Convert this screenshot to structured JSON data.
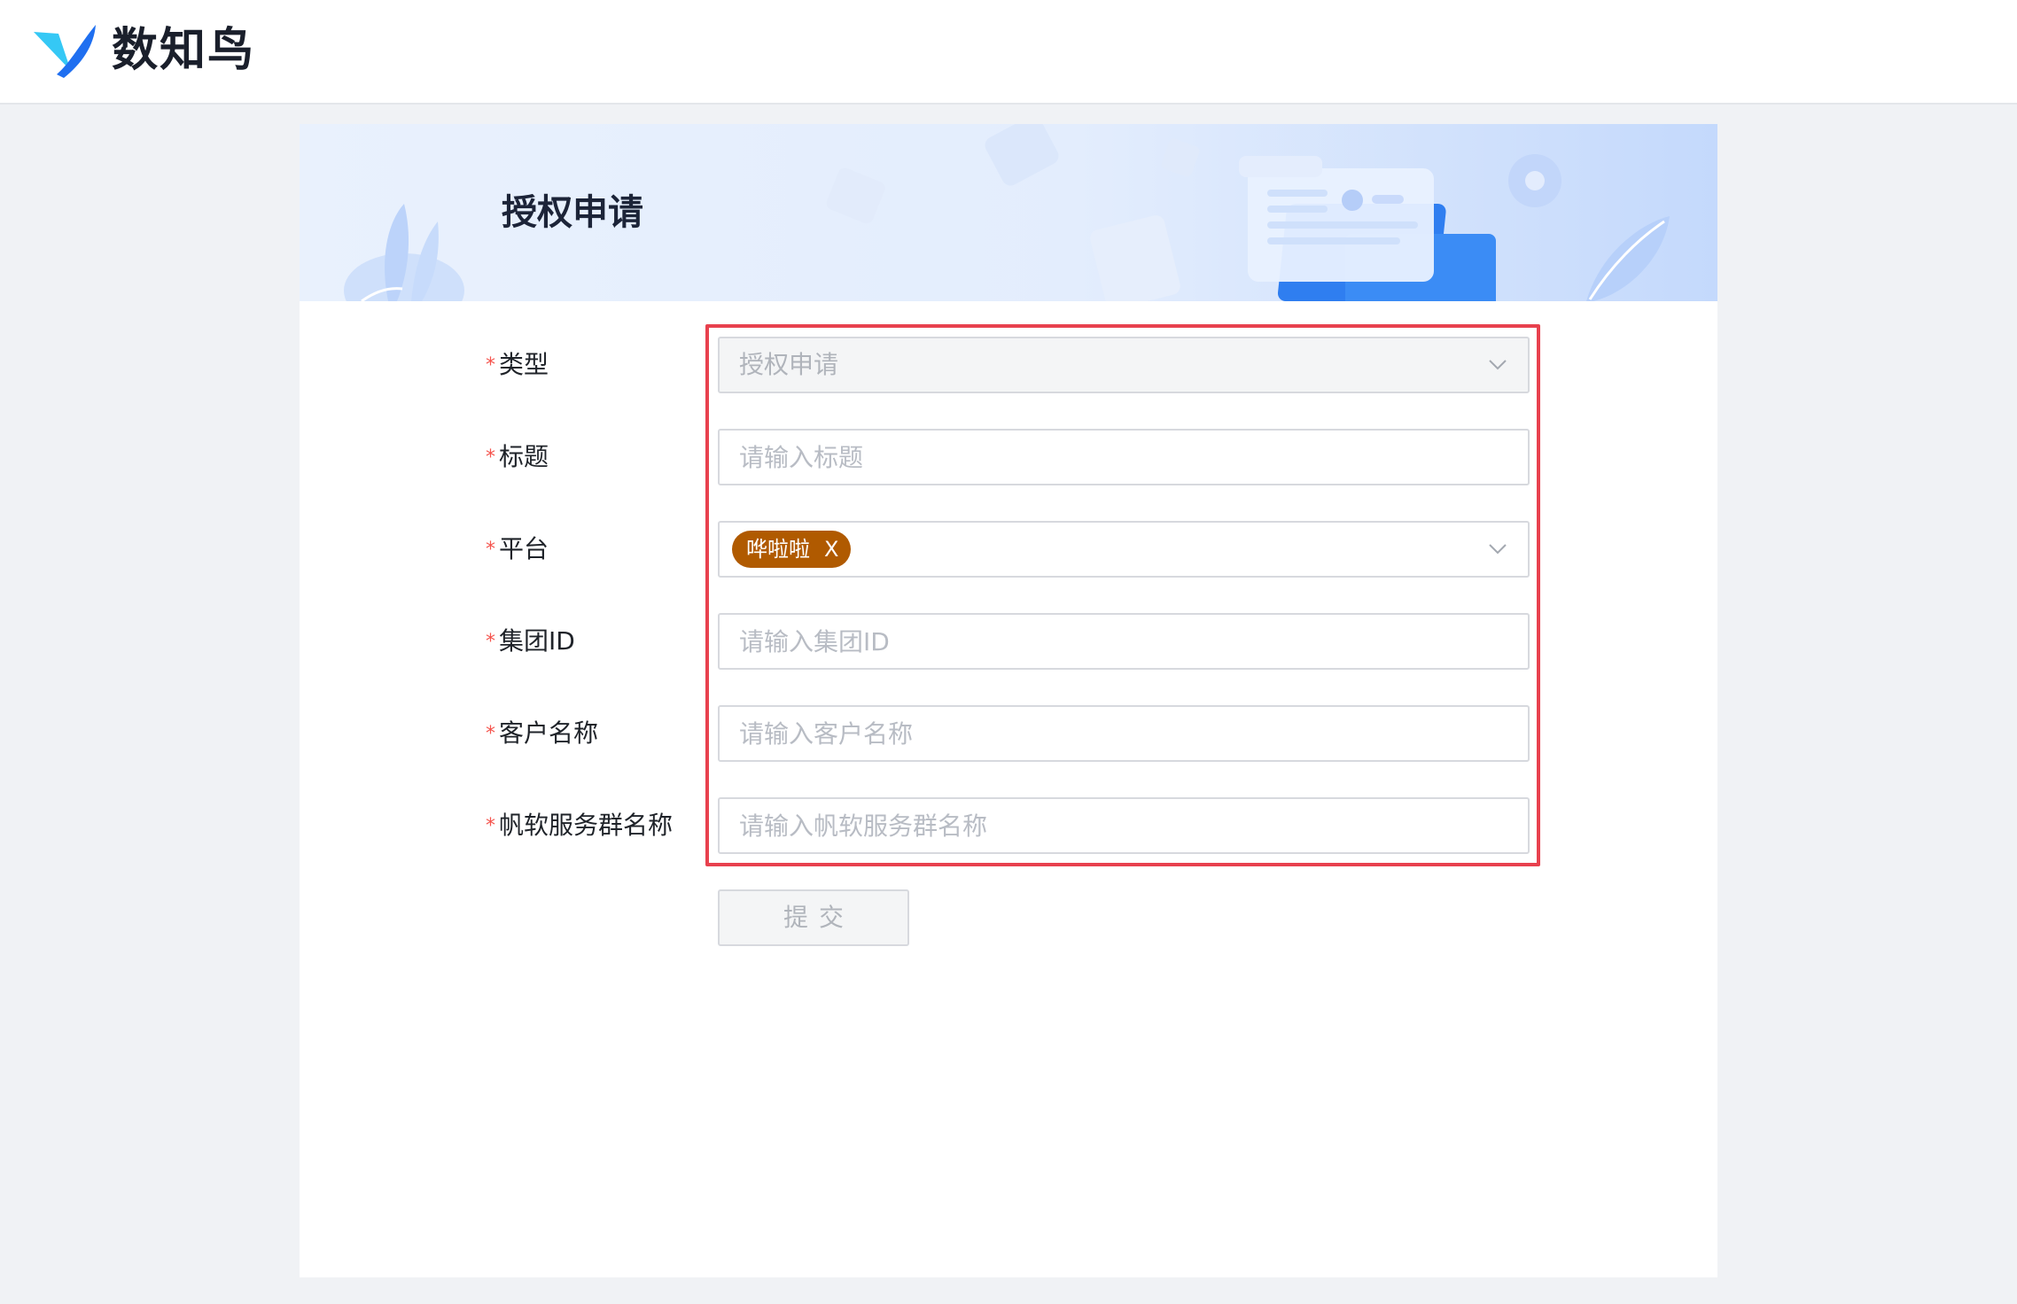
{
  "header": {
    "brand_name": "数知鸟",
    "logo_icon": "bird-logo-icon"
  },
  "banner": {
    "title": "授权申请"
  },
  "form": {
    "fields": [
      {
        "label": "类型",
        "required": true,
        "type": "select",
        "value": "授权申请",
        "disabled": true
      },
      {
        "label": "标题",
        "required": true,
        "type": "input",
        "placeholder": "请输入标题"
      },
      {
        "label": "平台",
        "required": true,
        "type": "multi-select",
        "tags": [
          "哗啦啦"
        ]
      },
      {
        "label": "集团ID",
        "required": true,
        "type": "input",
        "placeholder": "请输入集团ID"
      },
      {
        "label": "客户名称",
        "required": true,
        "type": "input",
        "placeholder": "请输入客户名称"
      },
      {
        "label": "帆软服务群名称",
        "required": true,
        "type": "input",
        "placeholder": "请输入帆软服务群名称"
      }
    ],
    "required_mark": "*",
    "tag_close": "X",
    "submit_label": "提交"
  },
  "colors": {
    "required_mark": "#f5544d",
    "tag_background": "#b05a00",
    "highlight_border": "#e8414e",
    "brand_blue": "#1f8cf5"
  }
}
